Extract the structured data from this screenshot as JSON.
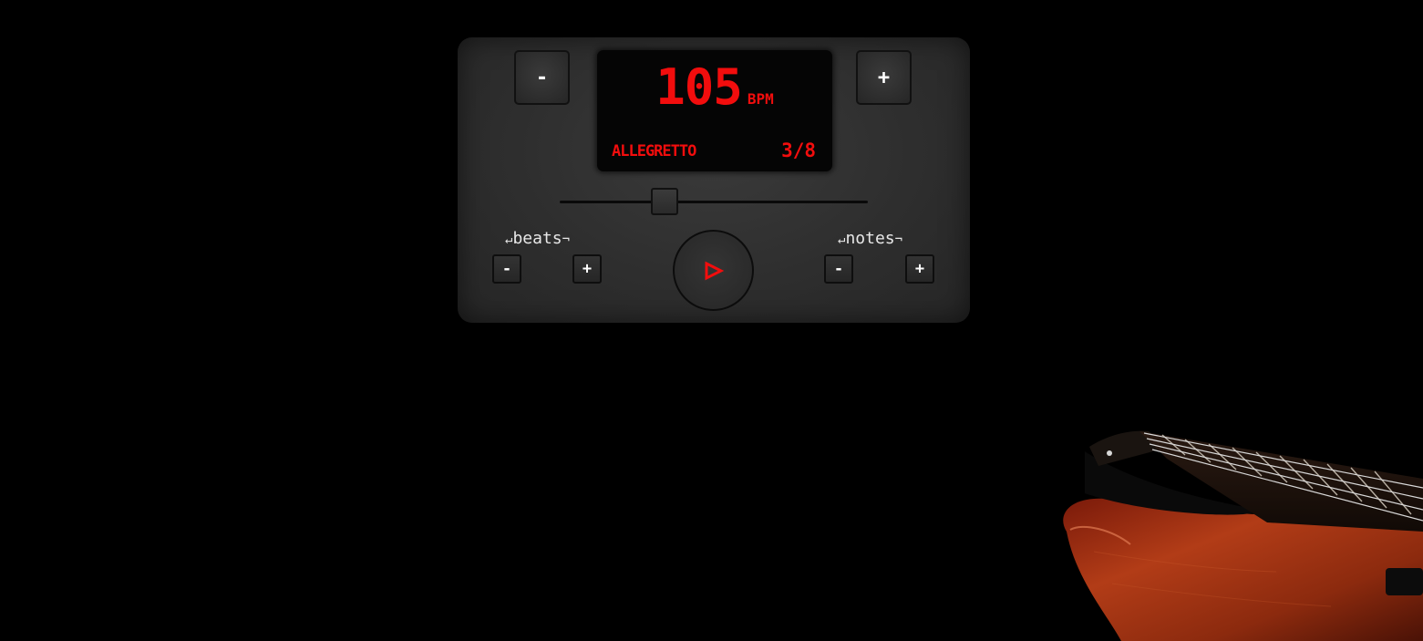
{
  "metronome": {
    "decrease_label": "-",
    "increase_label": "+",
    "bpm_value": "105",
    "bpm_unit": "BPM",
    "tempo_name": "ALLEGRETTO",
    "time_signature": "3/8",
    "tempo_slider_level_percent": 34,
    "play_icon": "play-icon",
    "accent_color": "#f20d0d"
  },
  "beats": {
    "label": "beats",
    "minus_label": "-",
    "plus_label": "+"
  },
  "notes": {
    "label": "notes",
    "minus_label": "-",
    "plus_label": "+"
  },
  "background_image": "bass-guitar-photo"
}
